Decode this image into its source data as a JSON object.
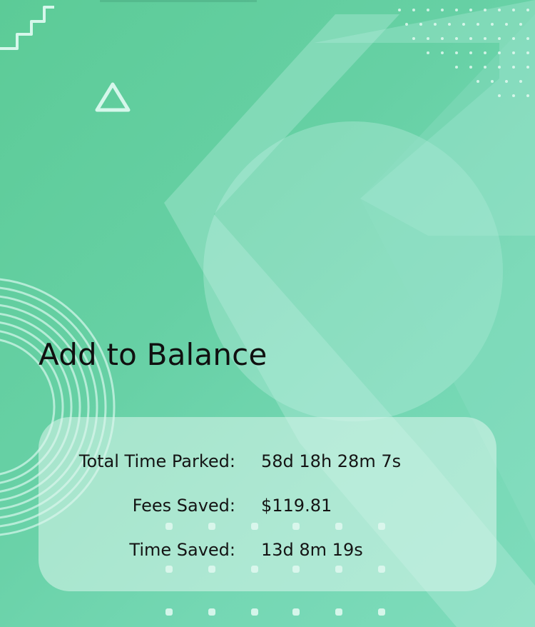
{
  "page": {
    "title": "Add to Balance"
  },
  "stats": [
    {
      "label": "Total Time Parked:",
      "value": "58d 18h 28m 7s"
    },
    {
      "label": "Fees Saved:",
      "value": "$119.81"
    },
    {
      "label": "Time Saved:",
      "value": "13d 8m 19s"
    }
  ],
  "colors": {
    "background": "#5ccb97",
    "accent_light": "#aeeadb",
    "card": "#dcf6ec",
    "text": "#111111"
  },
  "icons": [
    "triangle-outline-icon",
    "squiggle-line-decoration",
    "concentric-rings-decoration",
    "dot-grid-decoration"
  ]
}
